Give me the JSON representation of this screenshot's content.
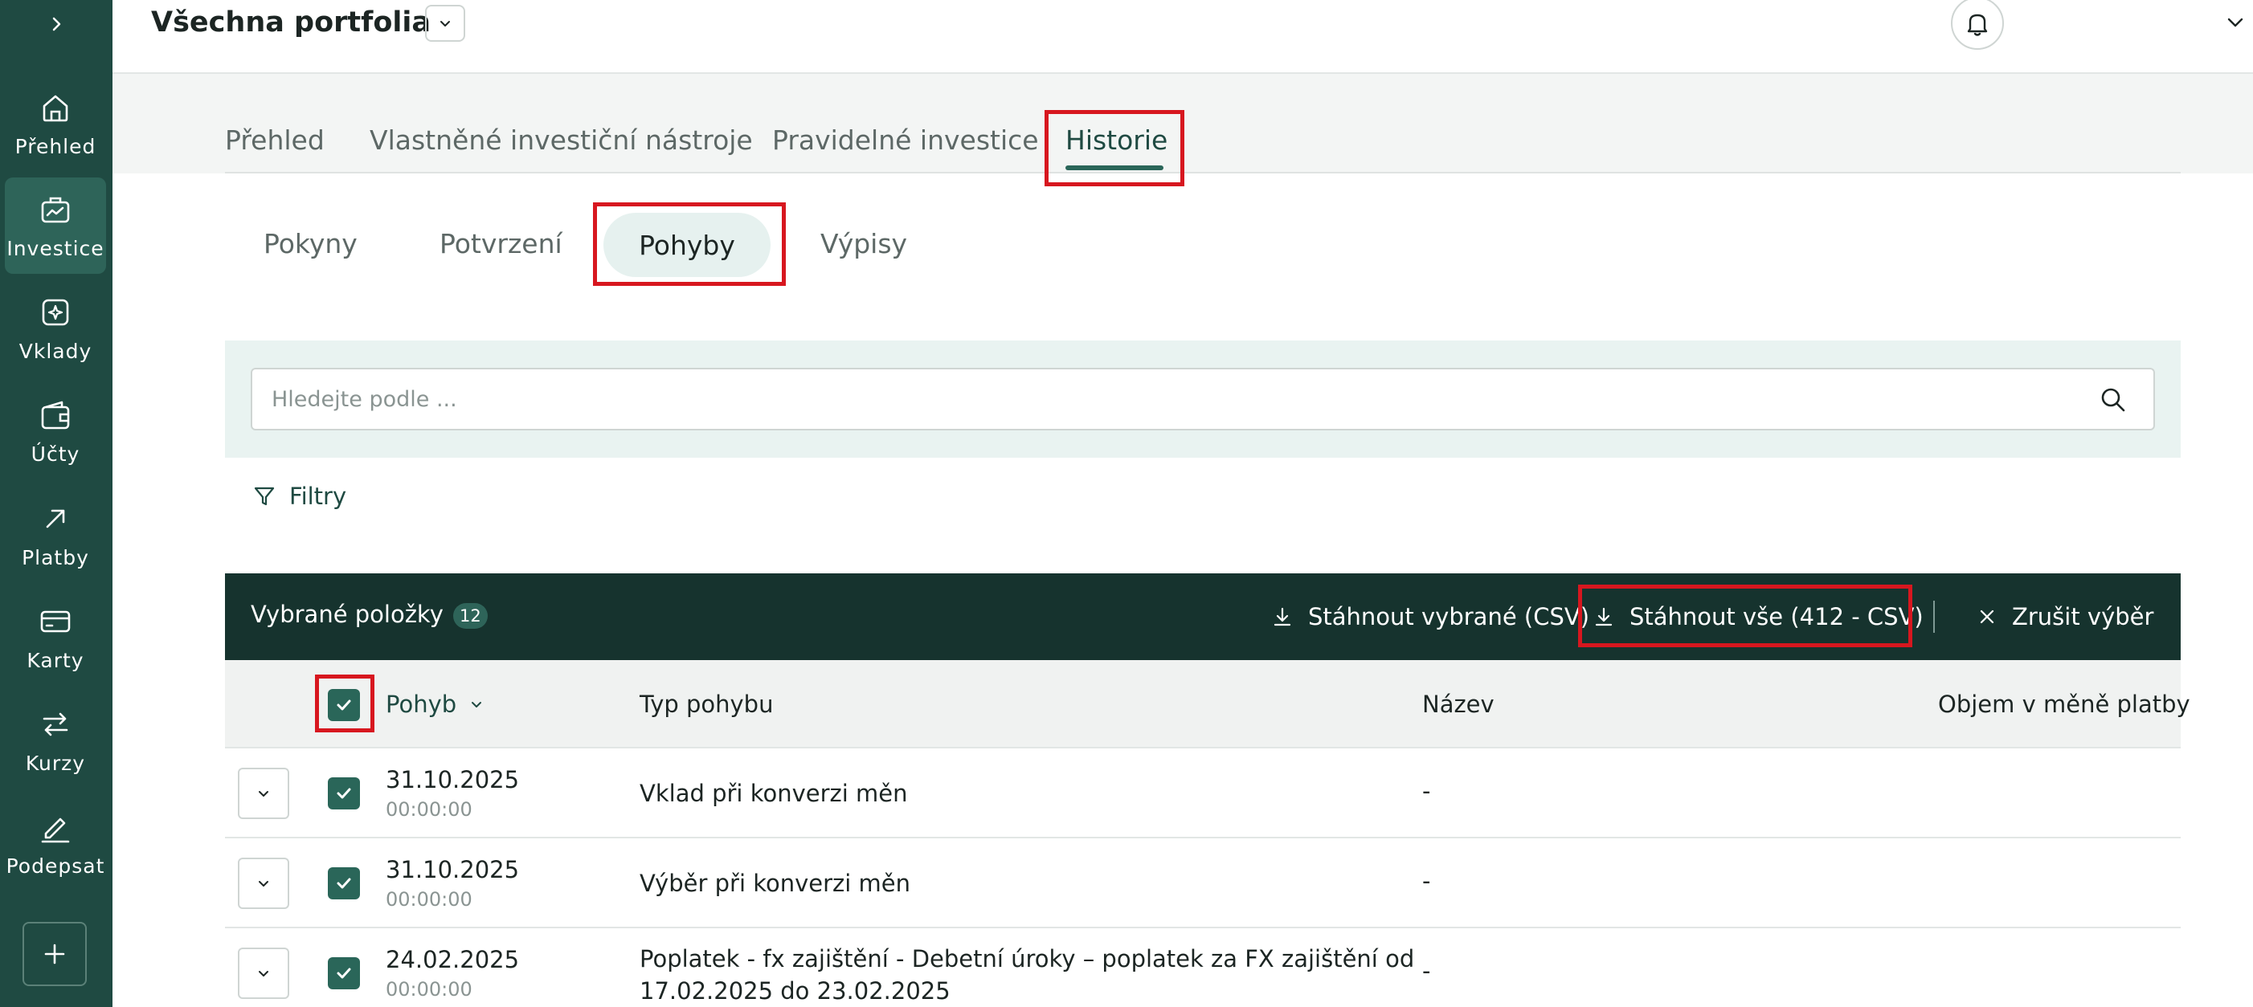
{
  "sidebar": {
    "items": [
      {
        "label": "Přehled",
        "icon": "home-icon"
      },
      {
        "label": "Investice",
        "icon": "briefcase-chart-icon"
      },
      {
        "label": "Vklady",
        "icon": "deposit-icon"
      },
      {
        "label": "Účty",
        "icon": "wallet-icon"
      },
      {
        "label": "Platby",
        "icon": "arrow-up-right-icon"
      },
      {
        "label": "Karty",
        "icon": "card-icon"
      },
      {
        "label": "Kurzy",
        "icon": "exchange-icon"
      },
      {
        "label": "Podepsat",
        "icon": "pen-icon"
      }
    ],
    "active": "Investice"
  },
  "header": {
    "title": "Všechna portfolia"
  },
  "tabs": [
    {
      "label": "Přehled"
    },
    {
      "label": "Vlastněné investiční nástroje"
    },
    {
      "label": "Pravidelné investice"
    },
    {
      "label": "Historie"
    }
  ],
  "active_tab": "Historie",
  "subtabs": [
    {
      "label": "Pokyny"
    },
    {
      "label": "Potvrzení"
    },
    {
      "label": "Pohyby"
    },
    {
      "label": "Výpisy"
    }
  ],
  "active_subtab": "Pohyby",
  "search": {
    "placeholder": "Hledejte podle ...",
    "value": ""
  },
  "filters": {
    "label": "Filtry"
  },
  "selection_bar": {
    "label": "Vybrané položky",
    "count": "12",
    "download_selected": "Stáhnout vybrané (CSV)",
    "download_all": "Stáhnout vše (412 - CSV)",
    "cancel": "Zrušit výběr"
  },
  "table": {
    "columns": [
      "Pohyb",
      "Typ pohybu",
      "Název",
      "Objem v měně platby"
    ],
    "rows": [
      {
        "date": "31.10.2025",
        "time": "00:00:00",
        "type": "Vklad při konverzi měn",
        "name": "-"
      },
      {
        "date": "31.10.2025",
        "time": "00:00:00",
        "type": "Výběr při konverzi měn",
        "name": "-"
      },
      {
        "date": "24.02.2025",
        "time": "00:00:00",
        "type": "Poplatek - fx zajištění - Debetní úroky – poplatek za FX zajištění od 17.02.2025 do 23.02.2025",
        "name": "-"
      }
    ]
  },
  "colors": {
    "sidebar_bg": "#1f4a42",
    "accent": "#2a6659",
    "selection_bar_bg": "#16332e",
    "highlight": "#d7171f"
  }
}
